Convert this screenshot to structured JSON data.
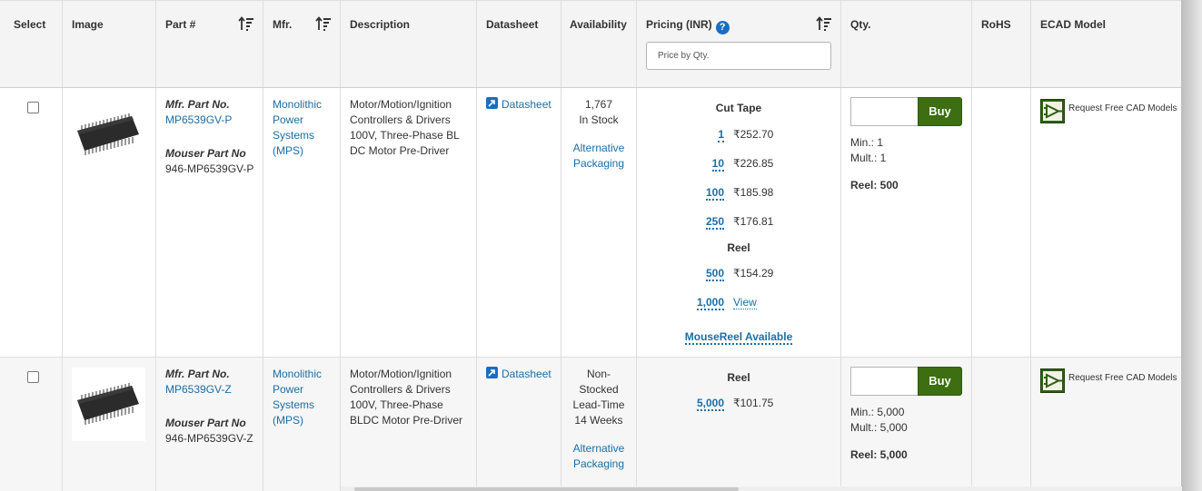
{
  "header": {
    "select": "Select",
    "image": "Image",
    "part": "Part #",
    "mfr": "Mfr.",
    "description": "Description",
    "datasheet": "Datasheet",
    "availability": "Availability",
    "pricing": "Pricing (INR)",
    "pricing_help": "?",
    "price_placeholder": "Price by Qty.",
    "qty": "Qty.",
    "rohs": "RoHS",
    "ecad": "ECAD Model"
  },
  "rows": [
    {
      "mfr_part_label": "Mfr. Part No.",
      "mfr_part": "MP6539GV-P",
      "mouser_part_label": "Mouser Part No",
      "mouser_part": "946-MP6539GV-P",
      "mfr_lines": [
        "Monolithic",
        "Power",
        "Systems",
        "(MPS)"
      ],
      "desc_lines": [
        "Motor/Motion/Ignition",
        "Controllers & Drivers",
        "100V, Three-Phase BL",
        "DC Motor Pre-Driver"
      ],
      "datasheet": "Datasheet",
      "avail_lines": [
        "1,767",
        "In Stock"
      ],
      "alt_lines": [
        "Alternative",
        "Packaging"
      ],
      "pricing": {
        "cut_tape_label": "Cut Tape",
        "cut_tape": [
          {
            "qty": "1",
            "price": "₹252.70"
          },
          {
            "qty": "10",
            "price": "₹226.85"
          },
          {
            "qty": "100",
            "price": "₹185.98"
          },
          {
            "qty": "250",
            "price": "₹176.81"
          }
        ],
        "reel_label": "Reel",
        "reel": [
          {
            "qty": "500",
            "price": "₹154.29"
          },
          {
            "qty": "1,000",
            "price": "View"
          }
        ],
        "mousereel": "MouseReel Available"
      },
      "buy": "Buy",
      "min": "Min.: 1",
      "mult": "Mult.: 1",
      "reel": "Reel: 500",
      "ecad_text": "Request Free CAD Models"
    },
    {
      "mfr_part_label": "Mfr. Part No.",
      "mfr_part": "MP6539GV-Z",
      "mouser_part_label": "Mouser Part No",
      "mouser_part": "946-MP6539GV-Z",
      "mfr_lines": [
        "Monolithic",
        "Power",
        "Systems",
        "(MPS)"
      ],
      "desc_lines": [
        "Motor/Motion/Ignition",
        "Controllers & Drivers",
        "100V, Three-Phase",
        "BLDC Motor Pre-Driver"
      ],
      "datasheet": "Datasheet",
      "avail_lines": [
        "Non-",
        "Stocked",
        "Lead-Time",
        "14 Weeks"
      ],
      "alt_lines": [
        "Alternative",
        "Packaging"
      ],
      "pricing": {
        "reel_label": "Reel",
        "reel": [
          {
            "qty": "5,000",
            "price": "₹101.75"
          }
        ]
      },
      "buy": "Buy",
      "min": "Min.: 5,000",
      "mult": "Mult.: 5,000",
      "reel": "Reel: 5,000",
      "ecad_text": "Request Free CAD Models"
    }
  ],
  "colors": {
    "link": "#1a6ea8",
    "buy_button": "#3d6e12",
    "help_icon": "#1a6ec1"
  }
}
